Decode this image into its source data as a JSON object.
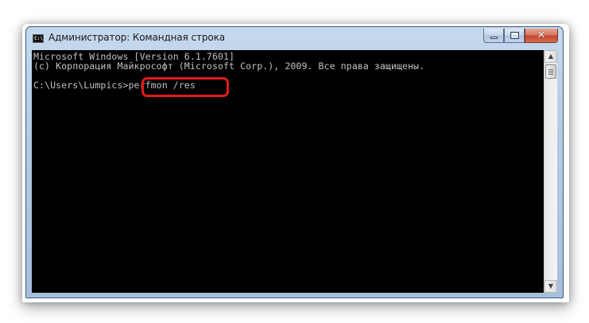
{
  "window": {
    "title": "Администратор: Командная строка",
    "icon": "cmd-icon",
    "icon_text": "C:\\"
  },
  "title_controls": {
    "minimize": "minimize-icon",
    "maximize": "maximize-icon",
    "close": "close-icon",
    "close_glyph": "✕"
  },
  "console": {
    "lines": [
      "Microsoft Windows [Version 6.1.7601]",
      "(c) Корпорация Майкрософт (Microsoft Corp.), 2009. Все права защищены.",
      "",
      "C:\\Users\\Lumpics>perfmon /res"
    ],
    "text_color": "#c0c0c0",
    "background": "#000000",
    "highlight_color": "#e4191c"
  },
  "scrollbar": {
    "up_arrow": "▲",
    "down_arrow": "▼"
  }
}
